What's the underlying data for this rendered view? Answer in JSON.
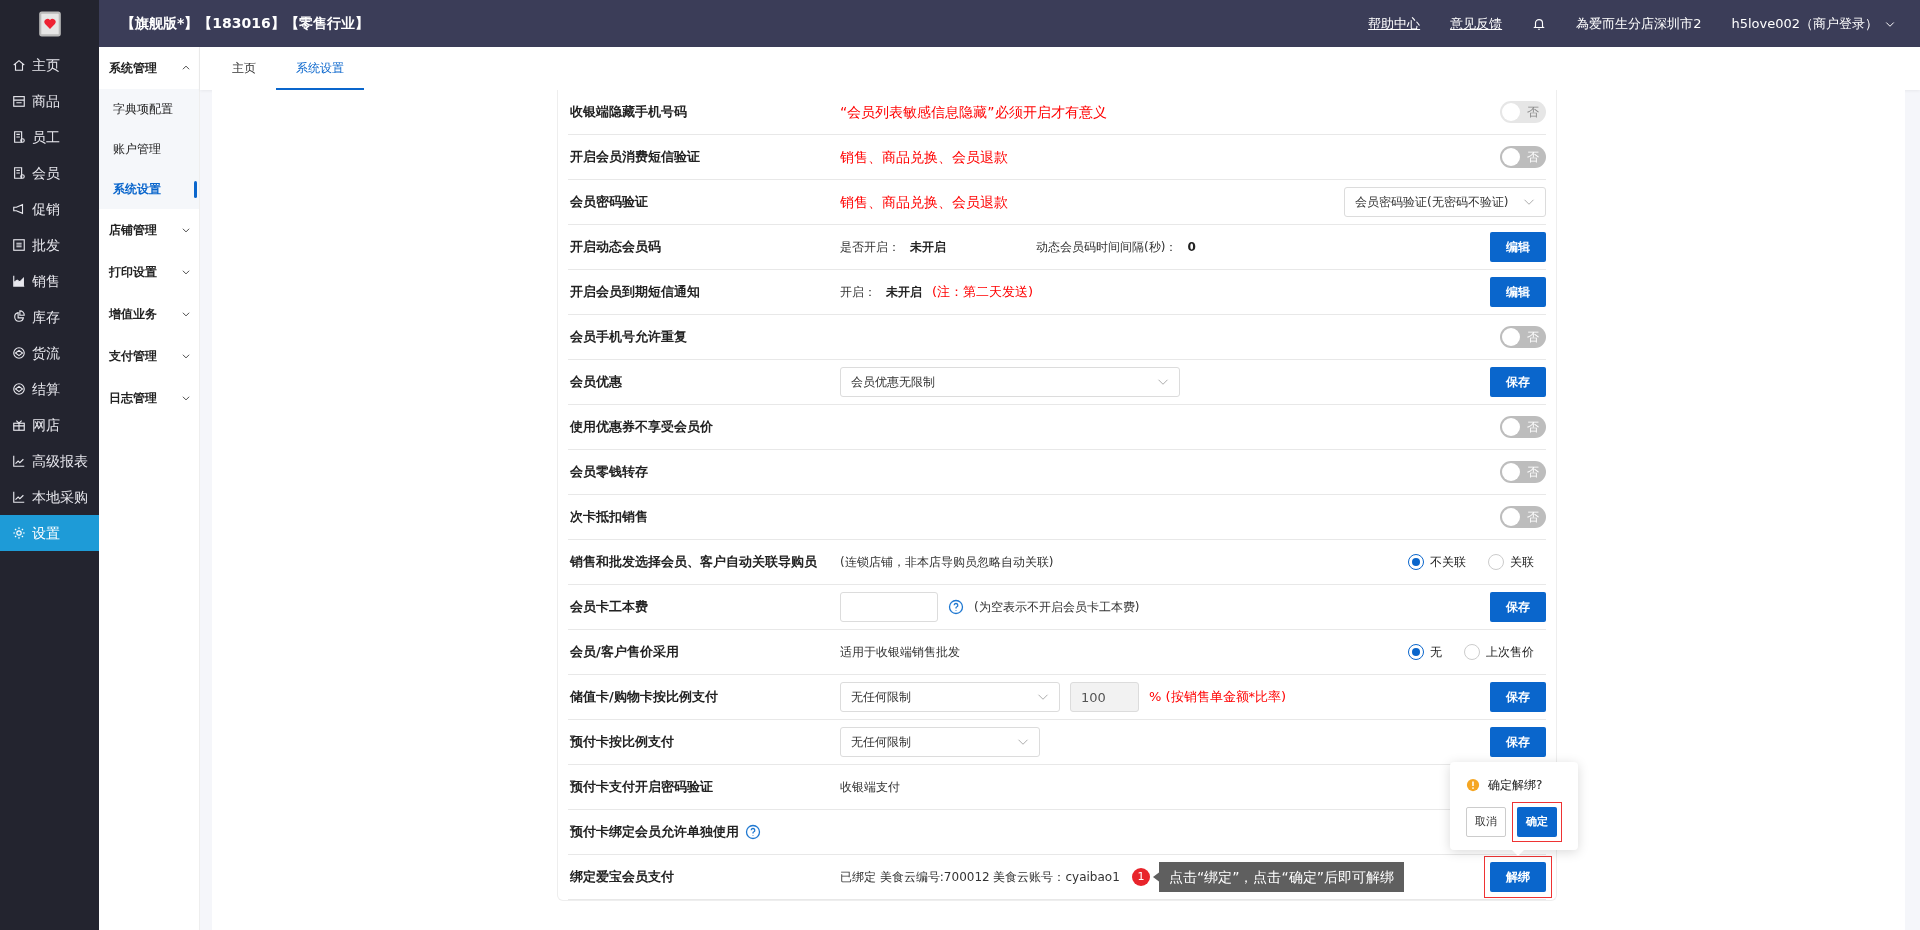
{
  "header": {
    "title": "【旗舰版*】【183016】【零售行业】",
    "links": [
      {
        "label": "帮助中心"
      },
      {
        "label": "意见反馈"
      }
    ],
    "store": "為爱而生分店深圳市2",
    "user": "h5love002（商户登录）"
  },
  "sidebar": {
    "items": [
      {
        "label": "主页",
        "selected": false
      },
      {
        "label": "商品",
        "selected": false
      },
      {
        "label": "员工",
        "selected": false
      },
      {
        "label": "会员",
        "selected": false
      },
      {
        "label": "促销",
        "selected": false
      },
      {
        "label": "批发",
        "selected": false
      },
      {
        "label": "销售",
        "selected": false
      },
      {
        "label": "库存",
        "selected": false
      },
      {
        "label": "货流",
        "selected": false
      },
      {
        "label": "结算",
        "selected": false
      },
      {
        "label": "网店",
        "selected": false
      },
      {
        "label": "高级报表",
        "selected": false
      },
      {
        "label": "本地采购",
        "selected": false
      },
      {
        "label": "设置",
        "selected": true
      }
    ]
  },
  "submenu": {
    "groups": [
      {
        "label": "系统管理",
        "expanded": true,
        "children": [
          {
            "label": "字典项配置",
            "selected": false
          },
          {
            "label": "账户管理",
            "selected": false
          },
          {
            "label": "系统设置",
            "selected": true
          }
        ]
      },
      {
        "label": "店铺管理",
        "expanded": false
      },
      {
        "label": "打印设置",
        "expanded": false
      },
      {
        "label": "增值业务",
        "expanded": false
      },
      {
        "label": "支付管理",
        "expanded": false
      },
      {
        "label": "日志管理",
        "expanded": false
      }
    ]
  },
  "tabs": [
    {
      "label": "主页",
      "selected": false
    },
    {
      "label": "系统设置",
      "selected": true
    }
  ],
  "settings": [
    {
      "label": "收银端隐藏手机号码",
      "details": [
        {
          "kind": "text",
          "color": "#ff0000",
          "text": "“会员列表敏感信息隐藏”必须开启才有意义"
        }
      ],
      "control": {
        "kind": "toggle",
        "text": "否",
        "on": false,
        "disabled": true
      }
    },
    {
      "label": "开启会员消费短信验证",
      "details": [
        {
          "kind": "text",
          "color": "#ff0000",
          "text": "销售、商品兑换、会员退款"
        }
      ],
      "control": {
        "kind": "toggle",
        "text": "否",
        "on": false,
        "disabled": false
      }
    },
    {
      "label": "会员密码验证",
      "details": [
        {
          "kind": "text",
          "color": "#ff0000",
          "text": "销售、商品兑换、会员退款"
        }
      ],
      "control": {
        "kind": "select",
        "value": "会员密码验证(无密码不验证)"
      }
    },
    {
      "label": "开启动态会员码",
      "details": [
        {
          "kind": "text",
          "text": "是否开启："
        },
        {
          "kind": "text",
          "bold": true,
          "text": "未开启"
        },
        {
          "kind": "text",
          "text": "动态会员码时间间隔(秒)："
        },
        {
          "kind": "text",
          "bold": true,
          "text": "0"
        }
      ],
      "control": {
        "kind": "button",
        "label": "编辑"
      }
    },
    {
      "label": "开启会员到期短信通知",
      "details": [
        {
          "kind": "text",
          "text": "开启："
        },
        {
          "kind": "text",
          "bold": true,
          "text": "未开启"
        },
        {
          "kind": "text",
          "color": "#ff0000",
          "text": "(注：第二天发送)"
        }
      ],
      "control": {
        "kind": "button",
        "label": "编辑"
      }
    },
    {
      "label": "会员手机号允许重复",
      "control": {
        "kind": "toggle",
        "text": "否",
        "on": false,
        "disabled": false
      }
    },
    {
      "label": "会员优惠",
      "details": [
        {
          "kind": "select",
          "value": "会员优惠无限制"
        }
      ],
      "control": {
        "kind": "button",
        "label": "保存"
      }
    },
    {
      "label": "使用优惠券不享受会员价",
      "control": {
        "kind": "toggle",
        "text": "否",
        "on": false,
        "disabled": false
      }
    },
    {
      "label": "会员零钱转存",
      "control": {
        "kind": "toggle",
        "text": "否",
        "on": false,
        "disabled": false
      }
    },
    {
      "label": "次卡抵扣销售",
      "control": {
        "kind": "toggle",
        "text": "否",
        "on": false,
        "disabled": false
      }
    },
    {
      "label": "销售和批发选择会员、客户自动关联导购员",
      "details": [
        {
          "kind": "text",
          "text": "(连锁店铺，非本店导购员忽略自动关联)"
        }
      ],
      "control": {
        "kind": "radio",
        "options": [
          {
            "label": "不关联",
            "selected": true
          },
          {
            "label": "关联",
            "selected": false
          }
        ]
      }
    },
    {
      "label": "会员卡工本费",
      "details": [
        {
          "kind": "input"
        },
        {
          "kind": "help"
        },
        {
          "kind": "text",
          "text": "(为空表示不开启会员卡工本费)"
        }
      ],
      "control": {
        "kind": "button",
        "label": "保存"
      }
    },
    {
      "label": "会员/客户售价采用",
      "details": [
        {
          "kind": "text",
          "text": "适用于收银端销售批发"
        }
      ],
      "control": {
        "kind": "radio",
        "options": [
          {
            "label": "无",
            "selected": true
          },
          {
            "label": "上次售价",
            "selected": false
          }
        ]
      }
    },
    {
      "label": "储值卡/购物卡按比例支付",
      "details": [
        {
          "kind": "select",
          "value": "无任何限制"
        },
        {
          "kind": "input",
          "value": "100",
          "disabled": true
        },
        {
          "kind": "text",
          "color": "#ff0000",
          "text": "% (按销售单金额*比率)"
        }
      ],
      "control": {
        "kind": "button",
        "label": "保存"
      }
    },
    {
      "label": "预付卡按比例支付",
      "details": [
        {
          "kind": "select",
          "value": "无任何限制"
        }
      ],
      "control": {
        "kind": "button",
        "label": "保存"
      }
    },
    {
      "label": "预付卡支付开启密码验证",
      "details": [
        {
          "kind": "text",
          "text": "收银端支付"
        }
      ]
    },
    {
      "label": "预付卡绑定会员允许单独使用",
      "help": true
    },
    {
      "label": "绑定爱宝会员支付",
      "details": [
        {
          "kind": "text",
          "text": "已绑定 美食云编号:700012 美食云账号：cyaibao1"
        }
      ],
      "annotation": {
        "step": "1",
        "text": "点击“绑定”，点击“确定”后即可解绑"
      },
      "control": {
        "kind": "button",
        "label": "解绑",
        "highlighted": true
      },
      "popover": {
        "message": "确定解绑?",
        "buttons": [
          {
            "label": "取消",
            "primary": false,
            "highlighted": false
          },
          {
            "label": "确定",
            "primary": true,
            "highlighted": true
          }
        ]
      }
    }
  ]
}
